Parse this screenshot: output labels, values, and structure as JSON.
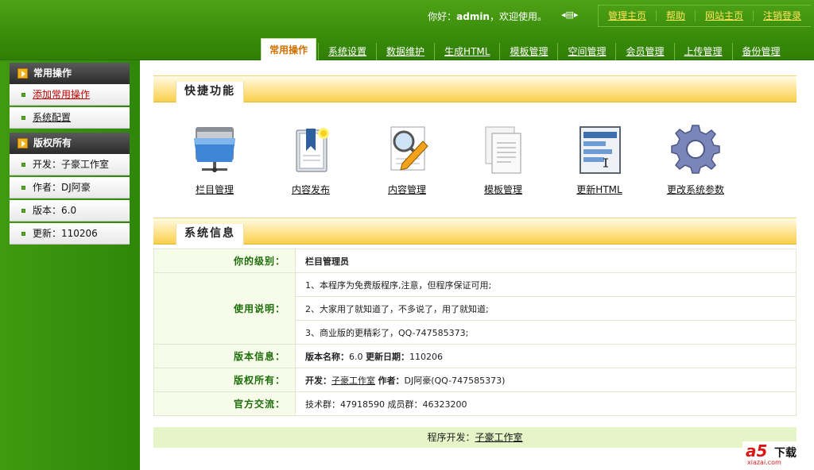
{
  "header": {
    "greeting_prefix": "你好：",
    "username": "admin",
    "greeting_suffix": "，欢迎使用。",
    "top_links": [
      "管理主页",
      "帮助",
      "网站主页",
      "注销登录"
    ],
    "nav_tabs": [
      "常用操作",
      "系统设置",
      "数据维护",
      "生成HTML",
      "模板管理",
      "空间管理",
      "会员管理",
      "上传管理",
      "备份管理"
    ],
    "active_tab": "常用操作"
  },
  "sidebar": {
    "sections": [
      {
        "title": "常用操作",
        "items": [
          "添加常用操作",
          "系统配置"
        ]
      },
      {
        "title": "版权所有",
        "items": [
          "开发：子豪工作室",
          "作者：DJ阿豪",
          "版本：6.0",
          "更新：110206"
        ]
      }
    ]
  },
  "quick": {
    "title": "快捷功能",
    "items": [
      {
        "label": "栏目管理",
        "icon": "folder-network-icon"
      },
      {
        "label": "内容发布",
        "icon": "book-bookmark-icon"
      },
      {
        "label": "内容管理",
        "icon": "magnifier-pencil-icon"
      },
      {
        "label": "模板管理",
        "icon": "document-pages-icon"
      },
      {
        "label": "更新HTML",
        "icon": "html-page-icon"
      },
      {
        "label": "更改系统参数",
        "icon": "gear-icon"
      }
    ]
  },
  "sysinfo": {
    "title": "系统信息",
    "level_label": "你的级别：",
    "level_value": "栏目管理员",
    "usage_label": "使用说明：",
    "usage_lines": [
      "1、本程序为免费版程序,注意，但程序保证可用;",
      "2、大家用了就知道了，不多说了，用了就知道;",
      "3、商业版的更精彩了，QQ-747585373;"
    ],
    "version_label": "版本信息：",
    "version_name_label": "版本名称：",
    "version_name": "6.0",
    "update_label": "更新日期：",
    "update_date": "110206",
    "copyright_label": "版权所有：",
    "dev_label": "开发：",
    "dev_name": "子豪工作室",
    "author_label": "作者：",
    "author_name": "DJ阿豪(QQ-747585373)",
    "contact_label": "官方交流：",
    "contact_value": "技术群：47918590 成员群：46323200"
  },
  "footer": {
    "prefix": "程序开发：",
    "link": "子豪工作室"
  },
  "watermark": {
    "logo": "a5",
    "text": "下载",
    "url": "xiazai.com"
  },
  "colors": {
    "brand_green": "#3a8c0a",
    "accent_yellow": "#ffe38f",
    "label_green": "#1d6e0a",
    "link_yellow": "#ffe55a",
    "hot_red": "#c00000"
  }
}
